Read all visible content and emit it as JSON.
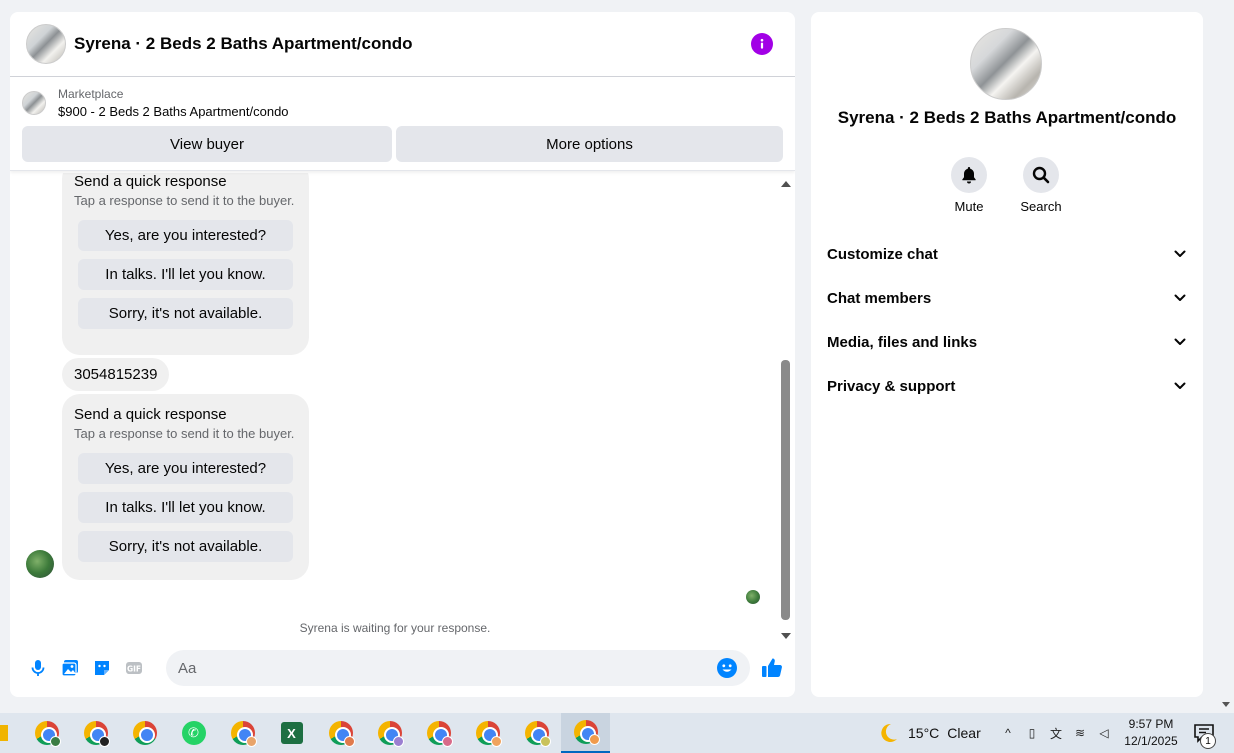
{
  "chat": {
    "title": "Syrena · 2 Beds 2 Baths Apartment/condo",
    "listing": {
      "label": "Marketplace",
      "price_title": "$900 - 2 Beds 2 Baths Apartment/condo",
      "view_buyer": "View buyer",
      "more_options": "More options"
    },
    "quick_response_1": {
      "title": "Send a quick response",
      "subtitle": "Tap a response to send it to the buyer.",
      "options": [
        "Yes, are you interested?",
        "In talks. I'll let you know.",
        "Sorry, it's not available."
      ]
    },
    "phone_message": "3054815239",
    "quick_response_2": {
      "title": "Send a quick response",
      "subtitle": "Tap a response to send it to the buyer.",
      "options": [
        "Yes, are you interested?",
        "In talks. I'll let you know.",
        "Sorry, it's not available."
      ]
    },
    "waiting_status": "Syrena is waiting for your response.",
    "composer": {
      "placeholder": "Aa",
      "icons": [
        "microphone-icon",
        "photo-icon",
        "sticker-icon",
        "gif-icon",
        "emoji-icon",
        "thumbs-up-icon"
      ]
    },
    "accent_color": "#0084ff",
    "info_color": "#a200e6"
  },
  "info_panel": {
    "title": "Syrena · 2 Beds 2 Baths Apartment/condo",
    "actions": [
      {
        "label": "Mute",
        "icon": "bell-icon"
      },
      {
        "label": "Search",
        "icon": "search-icon"
      }
    ],
    "sections": [
      "Customize chat",
      "Chat members",
      "Media, files and links",
      "Privacy & support"
    ]
  },
  "taskbar": {
    "weather_temp": "15°C",
    "weather_desc": "Clear",
    "time": "9:57 PM",
    "date": "12/1/2025",
    "notification_count": "1"
  }
}
